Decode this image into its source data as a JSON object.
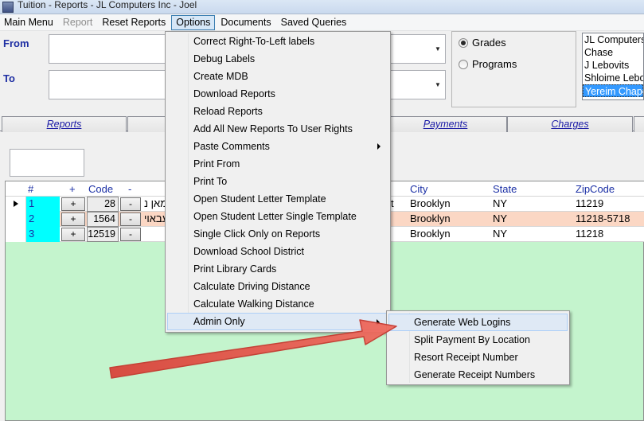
{
  "window": {
    "title": "Tuition - Reports - JL Computers Inc - Joel"
  },
  "menubar": {
    "items": [
      {
        "label": "Main Menu",
        "state": "normal"
      },
      {
        "label": "Report",
        "state": "disabled"
      },
      {
        "label": "Reset Reports",
        "state": "normal"
      },
      {
        "label": "Options",
        "state": "active"
      },
      {
        "label": "Documents",
        "state": "normal"
      },
      {
        "label": "Saved Queries",
        "state": "normal"
      }
    ]
  },
  "form": {
    "from_label": "From",
    "to_label": "To",
    "radio": {
      "grades": "Grades",
      "programs": "Programs",
      "selected": "Grades"
    },
    "list": [
      "JL Computers",
      "Chase",
      "J Lebovits",
      "Shloime Lebo",
      "Yereim Chape"
    ],
    "list_selected": "Yereim Chape"
  },
  "tabs": [
    "Reports",
    "Payments",
    "Charges"
  ],
  "grid": {
    "columns": {
      "num": "#",
      "plus": "+",
      "code": "Code",
      "minus": "-",
      "city": "City",
      "state": "State",
      "zip": "ZipCode"
    },
    "rows": [
      {
        "num": "1",
        "plus": "+",
        "code": "28",
        "minus": "-",
        "name_frag": "מאן נ",
        "city": "Brooklyn",
        "state": "NY",
        "zip": "11219",
        "frag2": "t"
      },
      {
        "num": "2",
        "plus": "+",
        "code": "1564",
        "minus": "-",
        "name_frag": "עבאוי",
        "city": "Brooklyn",
        "state": "NY",
        "zip": "11218-5718",
        "frag2": ""
      },
      {
        "num": "3",
        "plus": "+",
        "code": "12519",
        "minus": "-",
        "name_frag": "",
        "city": "Brooklyn",
        "state": "NY",
        "zip": "11218",
        "frag2": ""
      }
    ]
  },
  "options_menu": {
    "items": [
      {
        "label": "Correct Right-To-Left labels",
        "submenu": false
      },
      {
        "label": "Debug Labels",
        "submenu": false
      },
      {
        "label": "Create MDB",
        "submenu": false
      },
      {
        "label": "Download Reports",
        "submenu": false
      },
      {
        "label": "Reload Reports",
        "submenu": false
      },
      {
        "label": "Add All New Reports To User Rights",
        "submenu": false
      },
      {
        "label": "Paste Comments",
        "submenu": true
      },
      {
        "label": "Print From",
        "submenu": false
      },
      {
        "label": "Print To",
        "submenu": false
      },
      {
        "label": "Open Student Letter Template",
        "submenu": false
      },
      {
        "label": "Open Student Letter Single Template",
        "submenu": false
      },
      {
        "label": "Single Click Only on Reports",
        "submenu": false
      },
      {
        "label": "Download School District",
        "submenu": false
      },
      {
        "label": "Print Library Cards",
        "submenu": false
      },
      {
        "label": "Calculate Driving Distance",
        "submenu": false
      },
      {
        "label": "Calculate Walking Distance",
        "submenu": false
      },
      {
        "label": "Admin Only",
        "submenu": true
      }
    ],
    "highlighted": "Admin Only"
  },
  "admin_submenu": {
    "items": [
      "Generate Web Logins",
      "Split Payment By Location",
      "Resort Receipt Number",
      "Generate Receipt Numbers"
    ],
    "highlighted": "Generate Web Logins"
  },
  "colors": {
    "accent": "#3399ff",
    "grid_bg": "#c4f4cd",
    "row_highlight": "#fbd7c4",
    "num_col": "#00ffff",
    "annotation_arrow": "#e2574c"
  }
}
